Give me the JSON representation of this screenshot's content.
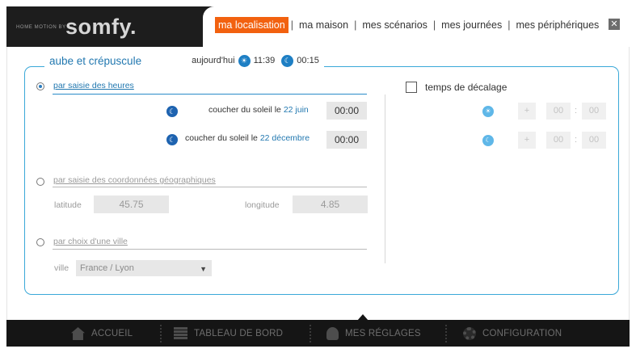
{
  "header": {
    "brand_small": "HOME MOTION BY",
    "brand_name": "somfy.",
    "tabs": [
      {
        "label": "ma localisation",
        "active": true
      },
      {
        "label": "ma maison",
        "active": false
      },
      {
        "label": "mes scénarios",
        "active": false
      },
      {
        "label": "mes journées",
        "active": false
      },
      {
        "label": "mes périphériques",
        "active": false
      }
    ],
    "separator": "|",
    "close_label": "✕"
  },
  "panel": {
    "title": "aube et crépuscule",
    "today_label": "aujourd'hui",
    "sunrise_time": "11:39",
    "sunset_time": "00:15"
  },
  "option_hours": {
    "label": "par saisie des heures",
    "selected": true,
    "row1_prefix": "coucher du soleil le ",
    "row1_date": "22 juin",
    "row1_value": "00:00",
    "row2_prefix": "coucher du soleil le ",
    "row2_date": "22 décembre",
    "row2_value": "00:00"
  },
  "option_coords": {
    "label": "par saisie des coordonnées géographiques",
    "selected": false,
    "latitude_label": "latitude",
    "latitude_value": "45.75",
    "longitude_label": "longitude",
    "longitude_value": "4.85"
  },
  "option_city": {
    "label": "par choix d'une ville",
    "selected": false,
    "city_label": "ville",
    "city_value": "France / Lyon"
  },
  "offset": {
    "label": "temps de décalage",
    "checked": false,
    "plus_label": "+",
    "rows": [
      {
        "hours": "00",
        "minutes": "00"
      },
      {
        "hours": "00",
        "minutes": "00"
      }
    ],
    "colon": ":"
  },
  "nav": {
    "items": [
      {
        "label": "ACCUEIL",
        "active": false
      },
      {
        "label": "TABLEAU DE BORD",
        "active": false
      },
      {
        "label": "MES RÉGLAGES",
        "active": true
      },
      {
        "label": "CONFIGURATION",
        "active": false
      }
    ]
  },
  "colors": {
    "accent": "#f2610f",
    "blue": "#2278b0",
    "panel_border": "#3aa8d8",
    "bar": "#1d1d1d"
  }
}
